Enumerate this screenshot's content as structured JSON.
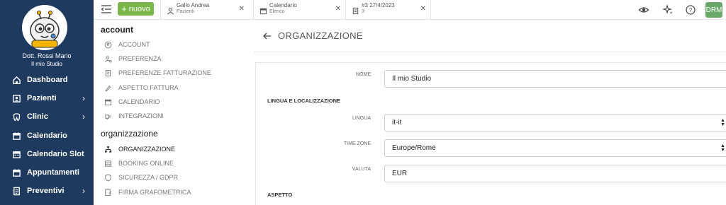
{
  "sidebar": {
    "user_name": "Dott. Rossi Mario",
    "studio": "Il mio Studio",
    "items": [
      {
        "label": "Dashboard",
        "has_chevron": false
      },
      {
        "label": "Pazienti",
        "has_chevron": true
      },
      {
        "label": "Clinic",
        "has_chevron": true
      },
      {
        "label": "Calendario",
        "has_chevron": false
      },
      {
        "label": "Calendario Slot",
        "has_chevron": false
      },
      {
        "label": "Appuntamenti",
        "has_chevron": false
      },
      {
        "label": "Preventivi",
        "has_chevron": true
      }
    ]
  },
  "topbar": {
    "new_label": "nuovo",
    "tabs": [
      {
        "title": "Gallo Andrea",
        "subtitle": "Pazienti",
        "icon": "user-icon"
      },
      {
        "title": "Calendario",
        "subtitle": "Elenco",
        "icon": "calendar-icon"
      },
      {
        "title": "#3 27/4/2023",
        "subtitle": "3",
        "icon": "document-icon"
      }
    ],
    "user_initials": "DRM"
  },
  "settings": {
    "account_title": "account",
    "account_items": [
      "ACCOUNT",
      "PREFERENZA",
      "PREFERENZE FATTURAZIONE",
      "ASPETTO FATTURA",
      "CALENDARIO",
      "INTEGRAZIONI"
    ],
    "org_title": "organizzazione",
    "org_items": [
      "ORGANIZZAZIONE",
      "BOOKING ONLINE",
      "SICUREZZA / GDPR",
      "FIRMA GRAFOMETRICA"
    ]
  },
  "main": {
    "title": "ORGANIZZAZIONE",
    "nome_label": "NOME",
    "nome_value": "Il mio Studio",
    "lingua_section": "LINGUA E LOCALIZZAZIONE",
    "lingua_label": "LINGUA",
    "lingua_value": "it-it",
    "timezone_label": "TIME ZONE",
    "timezone_value": "Europe/Rome",
    "valuta_label": "VALUTA",
    "valuta_value": "EUR",
    "aspetto_section": "ASPETTO"
  },
  "colors": {
    "sidebar_bg": "#1e3a5f",
    "new_button": "#7ab648",
    "avatar_badge": "#6aa86a"
  }
}
